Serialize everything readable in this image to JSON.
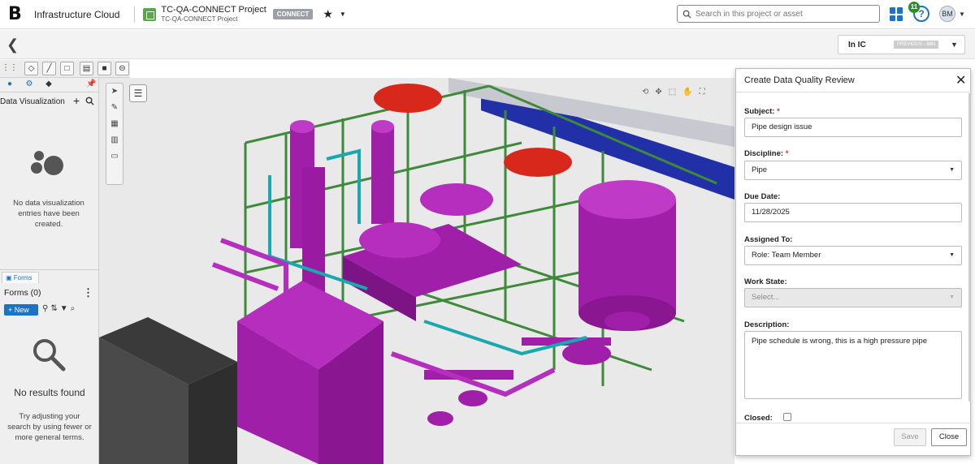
{
  "header": {
    "app_title": "Infrastructure Cloud",
    "project_name": "TC-QA-CONNECT Project",
    "project_sub": "TC-QA-CONNECT Project",
    "connect_badge": "CONNECT",
    "search_placeholder": "Search in this project or asset",
    "notifications_count": "11",
    "help_symbol": "?",
    "user_initials": "BM"
  },
  "subbar": {
    "version_label": "In IC",
    "version_badge": "PREVIOUS - 68N"
  },
  "left_panel": {
    "data_viz_title": "Data Visualization",
    "data_viz_empty": "No data visualization entries have been created.",
    "forms_tab": "Forms",
    "forms_title": "Forms (0)",
    "new_button": "+ New",
    "no_results": "No results found",
    "no_results_hint": "Try adjusting your search by using fewer or more general terms."
  },
  "dialog": {
    "title": "Create Data Quality Review",
    "subject_label": "Subject:",
    "subject_value": "Pipe design issue",
    "discipline_label": "Discipline:",
    "discipline_value": "Pipe",
    "due_date_label": "Due Date:",
    "due_date_value": "11/28/2025",
    "assigned_label": "Assigned To:",
    "assigned_value": "Role: Team Member",
    "work_state_label": "Work State:",
    "work_state_placeholder": "Select...",
    "description_label": "Description:",
    "description_value": "Pipe schedule is wrong,  this is a high pressure pipe",
    "closed_label": "Closed:",
    "save_label": "Save",
    "close_label": "Close"
  },
  "colors": {
    "accent": "#1b73c7",
    "model_magenta": "#a01fa8",
    "model_green": "#3f8a3a",
    "required": "#dd3333"
  }
}
